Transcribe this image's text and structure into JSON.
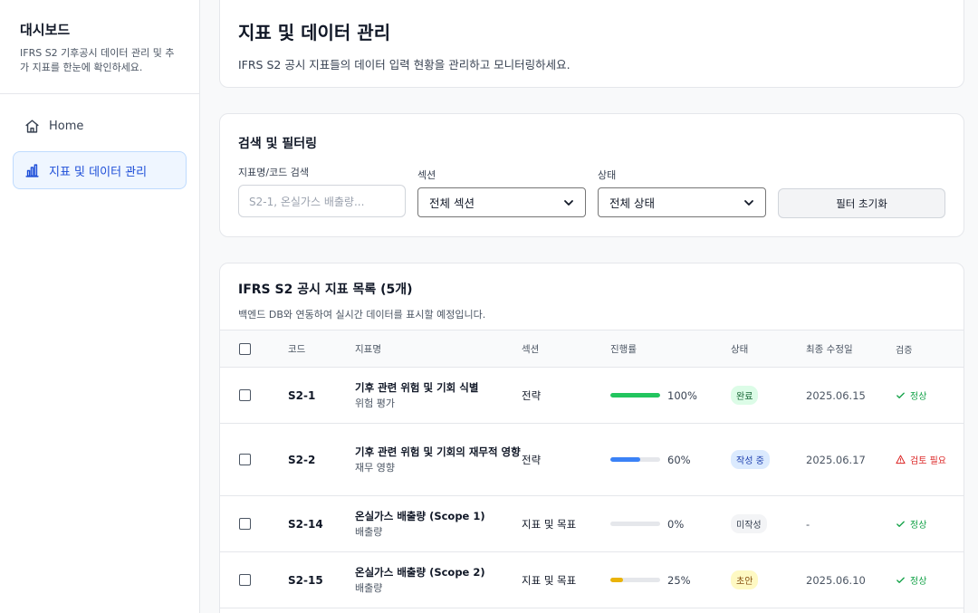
{
  "sidebar": {
    "title": "대시보드",
    "description": "IFRS S2 기후공시 데이터 관리 및 추가 지표를 한눈에 확인하세요.",
    "items": [
      {
        "label": "Home",
        "icon": "home-icon",
        "active": false
      },
      {
        "label": "지표 및 데이터 관리",
        "icon": "bar-chart-icon",
        "active": true
      }
    ]
  },
  "page": {
    "title": "지표 및 데이터 관리",
    "subtitle": "IFRS S2 공시 지표들의 데이터 입력 현황을 관리하고 모니터링하세요."
  },
  "filters": {
    "title": "검색 및 필터링",
    "search_label": "지표명/코드 검색",
    "search_placeholder": "S2-1, 온실가스 배출량...",
    "section_label": "섹션",
    "section_value": "전체 섹션",
    "status_label": "상태",
    "status_value": "전체 상태",
    "reset_label": "필터 초기화"
  },
  "table": {
    "title": "IFRS S2 공시 지표 목록 (5개)",
    "subtitle": "백엔드 DB와 연동하여 실시간 데이터를 표시할 예정입니다.",
    "headers": {
      "code": "코드",
      "name": "지표명",
      "section": "섹션",
      "progress": "진행률",
      "status": "상태",
      "updated": "최종 수정일",
      "verify": "검증"
    },
    "rows": [
      {
        "code": "S2-1",
        "name": "기후 관련 위험 및 기회 식별",
        "sub": "위험 평가",
        "section": "전략",
        "progress": 100,
        "progress_label": "100%",
        "bar_color": "#22c55e",
        "status": "완료",
        "status_bg": "#dcfce7",
        "status_fg": "#166534",
        "updated": "2025.06.15",
        "verify": "정상",
        "verify_ok": true
      },
      {
        "code": "S2-2",
        "name": "기후 관련 위험 및 기회의 재무적 영향",
        "sub": "재무 영향",
        "section": "전략",
        "progress": 60,
        "progress_label": "60%",
        "bar_color": "#3b82f6",
        "status": "작성 중",
        "status_bg": "#dbeafe",
        "status_fg": "#1e40af",
        "updated": "2025.06.17",
        "verify": "검토 필요",
        "verify_ok": false
      },
      {
        "code": "S2-14",
        "name": "온실가스 배출량 (Scope 1)",
        "sub": "배출량",
        "section": "지표 및 목표",
        "progress": 0,
        "progress_label": "0%",
        "bar_color": "#9ca3af",
        "status": "미작성",
        "status_bg": "#f3f4f6",
        "status_fg": "#374151",
        "updated": "-",
        "verify": "정상",
        "verify_ok": true
      },
      {
        "code": "S2-15",
        "name": "온실가스 배출량 (Scope 2)",
        "sub": "배출량",
        "section": "지표 및 목표",
        "progress": 25,
        "progress_label": "25%",
        "bar_color": "#eab308",
        "status": "초안",
        "status_bg": "#fef9c3",
        "status_fg": "#854d0e",
        "updated": "2025.06.10",
        "verify": "정상",
        "verify_ok": true
      }
    ]
  }
}
